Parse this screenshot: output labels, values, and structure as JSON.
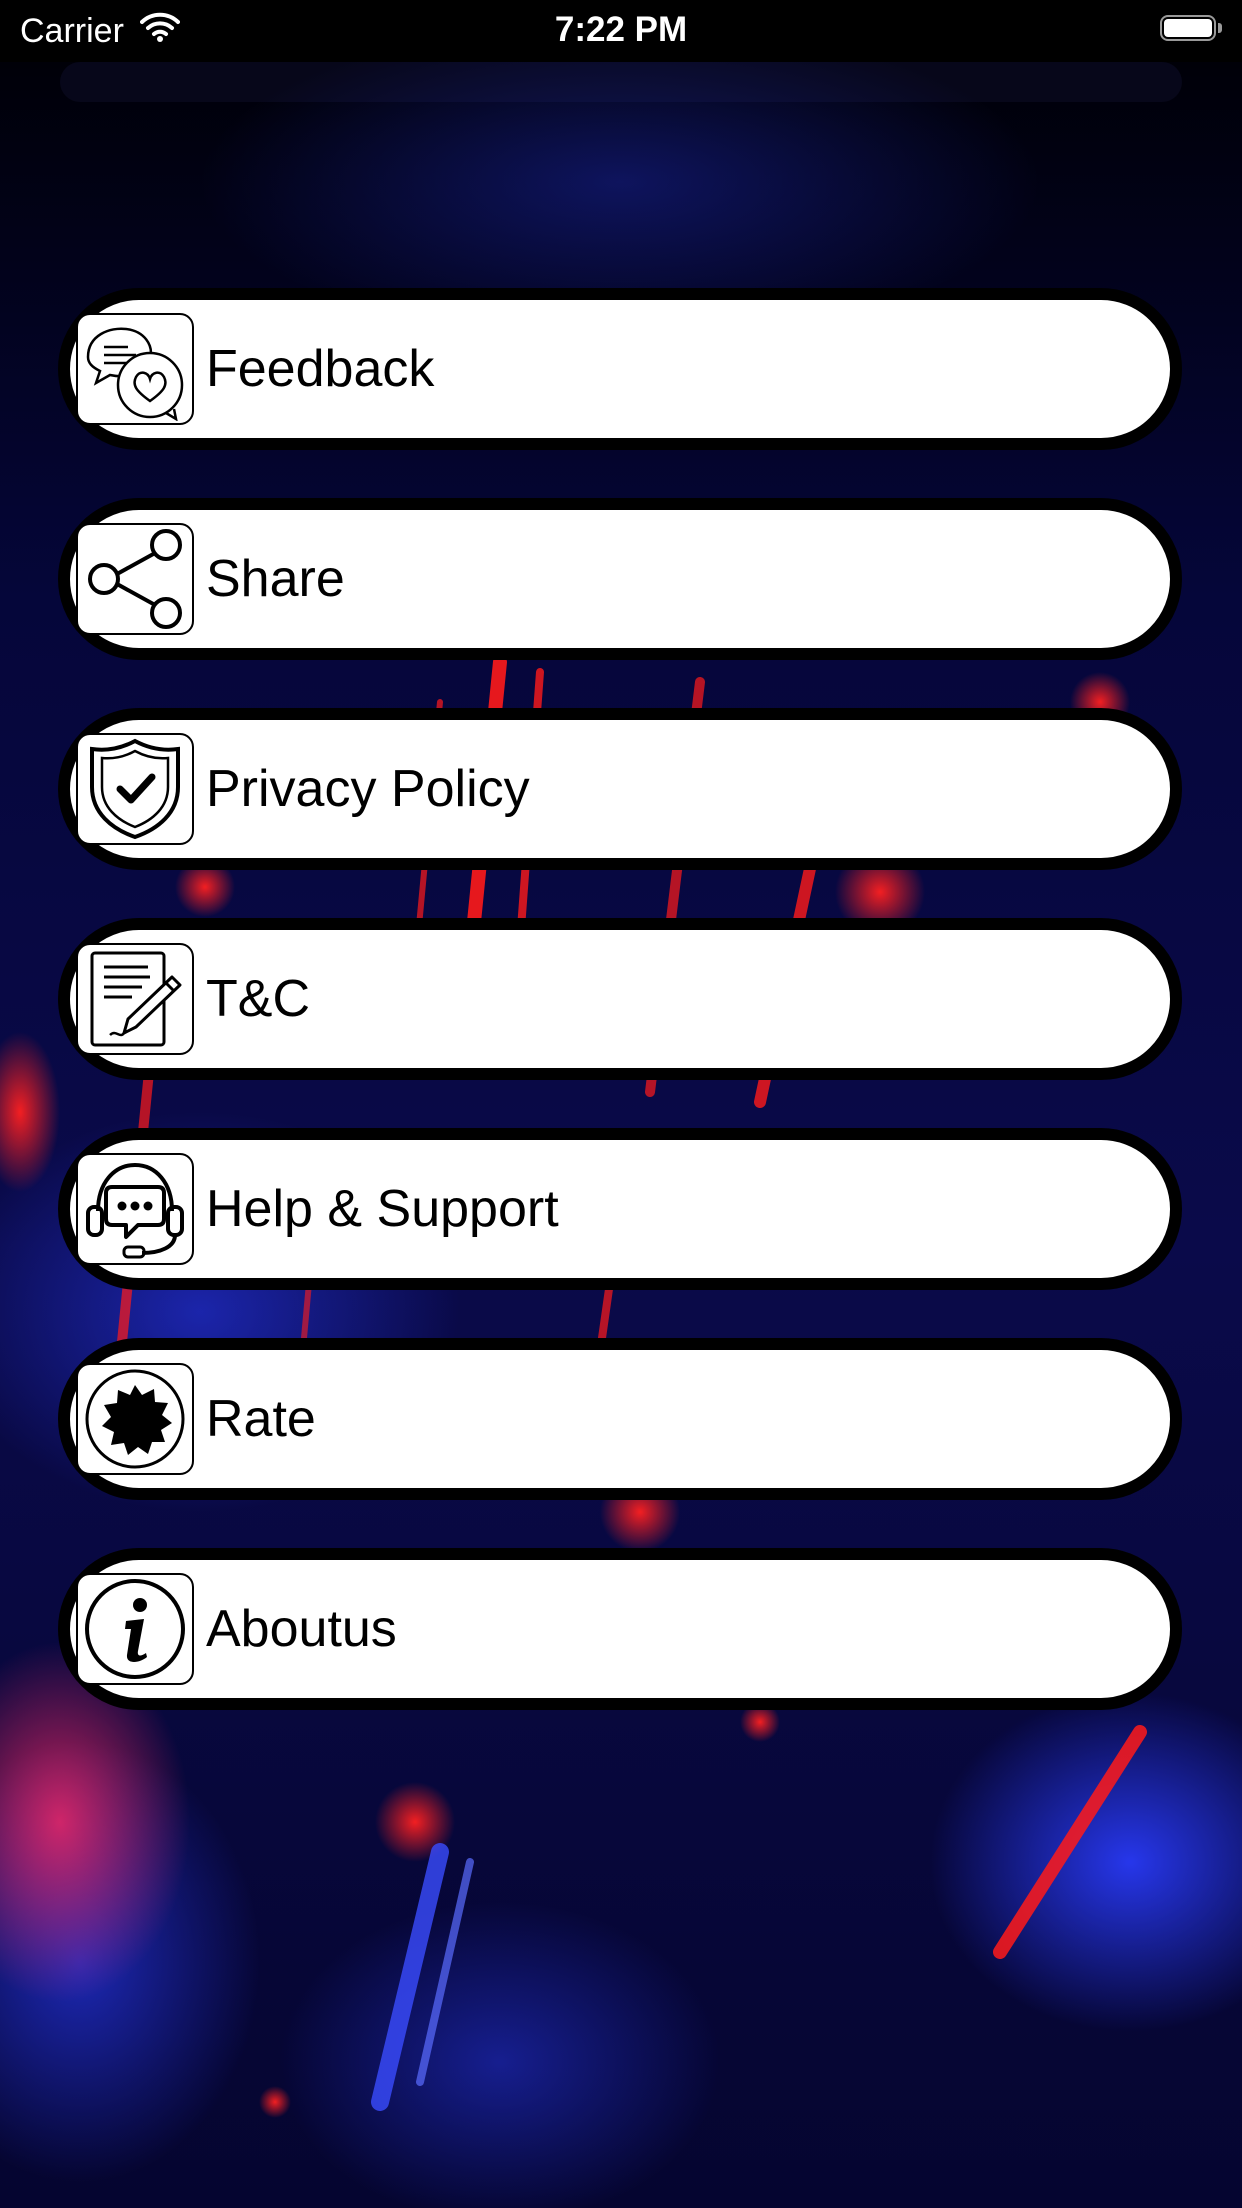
{
  "status_bar": {
    "carrier": "Carrier",
    "time": "7:22 PM",
    "icons": [
      "wifi-icon",
      "battery-icon"
    ]
  },
  "menu": {
    "items": [
      {
        "label": "Feedback",
        "icon": "feedback-icon"
      },
      {
        "label": "Share",
        "icon": "share-icon"
      },
      {
        "label": "Privacy Policy",
        "icon": "shield-check-icon"
      },
      {
        "label": "T&C",
        "icon": "document-pen-icon"
      },
      {
        "label": "Help & Support",
        "icon": "headset-chat-icon"
      },
      {
        "label": "Rate",
        "icon": "badge-icon"
      },
      {
        "label": "Aboutus",
        "icon": "info-icon"
      }
    ]
  },
  "colors": {
    "background": "#000000",
    "accent_red": "#ff1a1a",
    "accent_blue": "#1a28ff",
    "button_fill": "#ffffff",
    "button_border": "#000000"
  }
}
